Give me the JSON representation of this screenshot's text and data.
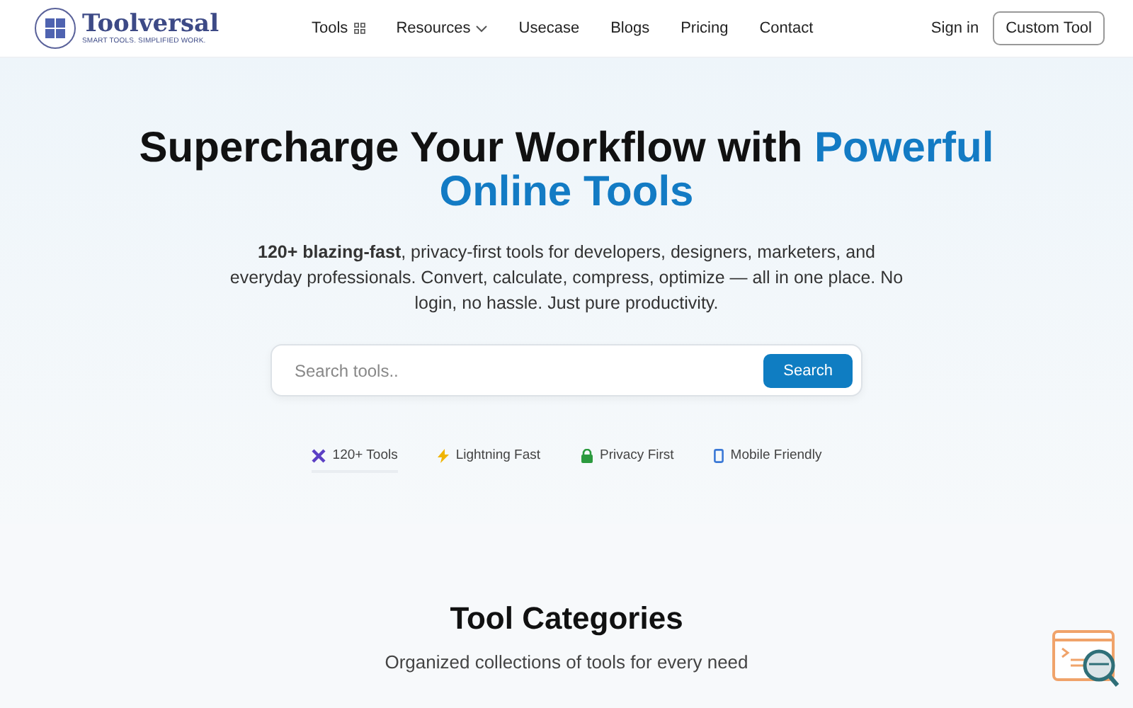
{
  "header": {
    "logo": {
      "name": "Toolversal",
      "tagline": "SMART TOOLS. SIMPLIFIED WORK."
    },
    "nav": [
      {
        "label": "Tools",
        "kind": "grid"
      },
      {
        "label": "Resources",
        "kind": "dropdown"
      },
      {
        "label": "Usecase",
        "kind": "plain"
      },
      {
        "label": "Blogs",
        "kind": "plain"
      },
      {
        "label": "Pricing",
        "kind": "plain"
      },
      {
        "label": "Contact",
        "kind": "plain"
      }
    ],
    "sign_in": "Sign in",
    "cta": "Custom Tool"
  },
  "hero": {
    "title": "Supercharge Your Workflow with",
    "title_highlight": "Powerful Online Tools",
    "description": "**120+ blazing-fast**, privacy-first tools for developers, designers, marketers, and everyday professionals. Convert, calculate, compress, optimize — all in one place. No login, no hassle. Just pure productivity.",
    "search": {
      "placeholder": "Search tools..",
      "button": "Search"
    },
    "features": [
      {
        "label": "120+ Tools",
        "kind": "tools",
        "selected": true
      },
      {
        "label": "Lightning Fast",
        "kind": "bolt",
        "selected": false
      },
      {
        "label": "Privacy First",
        "kind": "lock",
        "selected": false
      },
      {
        "label": "Mobile Friendly",
        "kind": "phone",
        "selected": false
      }
    ]
  },
  "categories": {
    "title": "Tool Categories",
    "subtitle": "Organized collections of tools for every need"
  }
}
